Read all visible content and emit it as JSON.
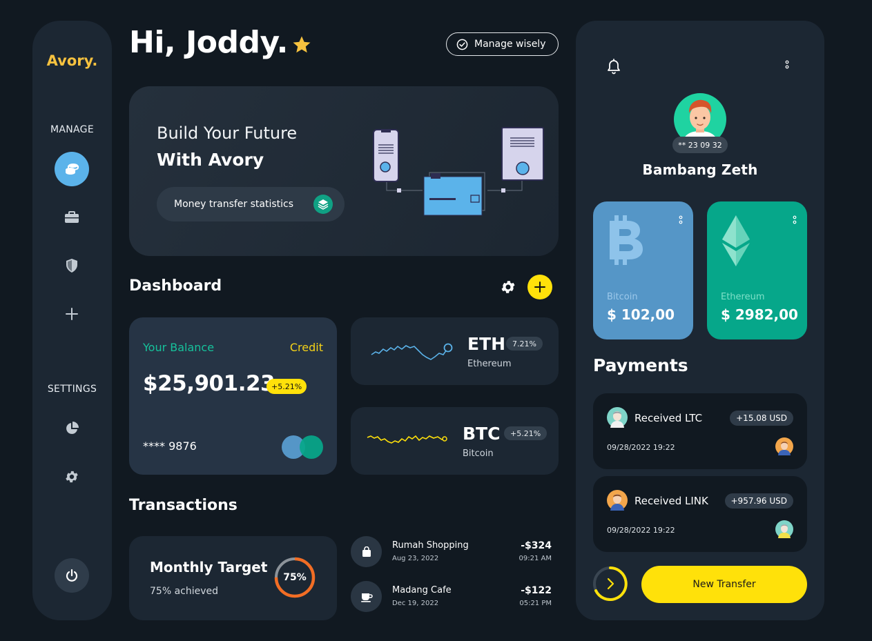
{
  "app": {
    "logo": "Avory."
  },
  "sidebar": {
    "manage_label": "MANAGE",
    "settings_label": "SETTINGS",
    "items": [
      {
        "icon": "coins-icon",
        "active": true
      },
      {
        "icon": "briefcase-icon"
      },
      {
        "icon": "shield-icon"
      },
      {
        "icon": "plus-icon"
      },
      {
        "icon": "pie-chart-icon"
      },
      {
        "icon": "gear-icon"
      }
    ],
    "power_icon": "power-icon"
  },
  "header": {
    "greeting": "Hi, Joddy.",
    "manage_button": "Manage wisely"
  },
  "hero": {
    "line1": "Build Your Future",
    "line2": "With Avory",
    "pill_label": "Money transfer statistics"
  },
  "dashboard": {
    "title": "Dashboard",
    "balance": {
      "label": "Your Balance",
      "type": "Credit",
      "amount": "$25,901.23",
      "change": "+5.21%",
      "card_number": "**** 9876"
    },
    "coins": [
      {
        "symbol": "ETH",
        "name": "Ethereum",
        "change": "7.21%",
        "color": "#5bb3ea"
      },
      {
        "symbol": "BTC",
        "name": "Bitcoin",
        "change": "+5.21%",
        "color": "#ffe10a"
      }
    ]
  },
  "transactions": {
    "title": "Transactions",
    "target": {
      "title": "Monthly Target",
      "subtitle": "75% achieved",
      "percent_label": "75%",
      "percent": 75
    },
    "items": [
      {
        "name": "Rumah Shopping",
        "date": "Aug 23, 2022",
        "amount": "-$324",
        "time": "09:21 AM",
        "icon": "shopping-bag-icon"
      },
      {
        "name": "Madang Cafe",
        "date": "Dec 19, 2022",
        "amount": "-$122",
        "time": "05:21 PM",
        "icon": "coffee-cup-icon"
      }
    ]
  },
  "profile": {
    "name": "Bambang Zeth",
    "badge": "** 23 09 32"
  },
  "wallets": [
    {
      "name": "Bitcoin",
      "value": "$ 102,00",
      "color": "#5596c7"
    },
    {
      "name": "Ethereum",
      "value": "$ 2982,00",
      "color": "#06a78a"
    }
  ],
  "payments": {
    "title": "Payments",
    "items": [
      {
        "label": "Received LTC",
        "amount": "+15.08 USD",
        "date": "09/28/2022 19:22"
      },
      {
        "label": "Received LINK",
        "amount": "+957.96 USD",
        "date": "09/28/2022 19:22"
      }
    ],
    "new_transfer": "New Transfer"
  },
  "colors": {
    "accent_yellow": "#ffe10a",
    "green": "#10a184",
    "blue": "#5bb3ea",
    "bg": "#111921",
    "card": "#1c2733"
  }
}
